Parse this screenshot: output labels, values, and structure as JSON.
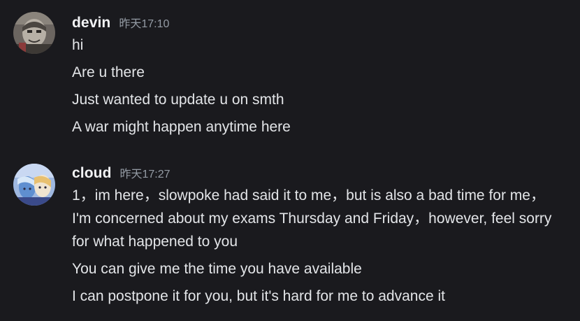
{
  "messages": [
    {
      "username": "devin",
      "timestamp": "昨天17:10",
      "lines": [
        "hi",
        "Are u there",
        "Just wanted to update u on smth",
        "A war might happen anytime here"
      ]
    },
    {
      "username": "cloud",
      "timestamp": "昨天17:27",
      "lines": [
        "1，im here，slowpoke had said it to me，but is also a bad time for me，I'm concerned about my exams Thursday and Friday，however, feel sorry for what happened to you",
        "You can give me the time you have available",
        "I can postpone it for you, but it's hard for me to advance it"
      ]
    }
  ],
  "colors": {
    "background": "#1a1a1e",
    "username": "#f2f3f5",
    "timestamp": "#949ba4",
    "message_text": "#e3e5e8"
  }
}
